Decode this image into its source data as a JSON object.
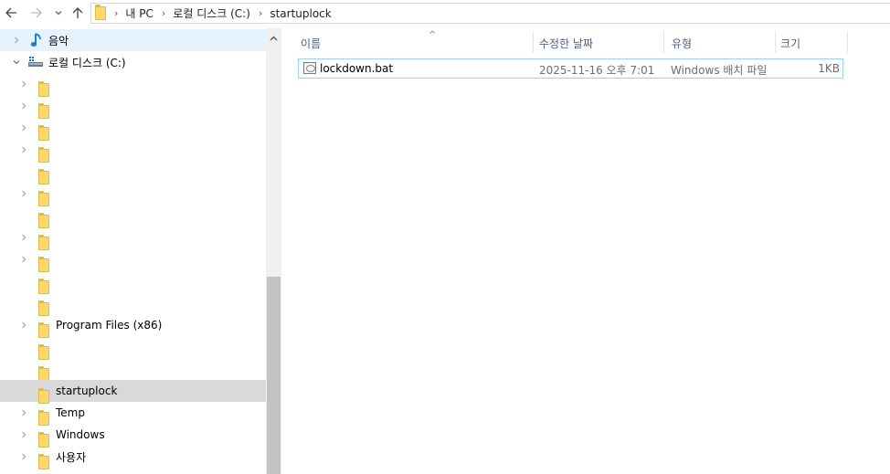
{
  "toolbar": {
    "back_icon": "arrow-left-icon",
    "forward_icon": "arrow-right-icon",
    "recent_icon": "chevron-down-icon",
    "up_icon": "arrow-up-icon"
  },
  "address": {
    "crumbs": [
      "내 PC",
      "로컬 디스크 (C:)",
      "startuplock"
    ]
  },
  "nav": {
    "music_label": "음악",
    "drive_label": "로컬 디스크 (C:)",
    "folders": [
      {
        "label": "",
        "expandable": true
      },
      {
        "label": "",
        "expandable": true
      },
      {
        "label": "",
        "expandable": true
      },
      {
        "label": "",
        "expandable": true
      },
      {
        "label": "",
        "expandable": false
      },
      {
        "label": "",
        "expandable": true
      },
      {
        "label": "",
        "expandable": false
      },
      {
        "label": "",
        "expandable": true
      },
      {
        "label": "",
        "expandable": true
      },
      {
        "label": "",
        "expandable": false
      },
      {
        "label": "",
        "expandable": false
      },
      {
        "label": "Program Files (x86)",
        "expandable": true
      },
      {
        "label": "",
        "expandable": false
      },
      {
        "label": "",
        "expandable": false
      },
      {
        "label": "startuplock",
        "expandable": false,
        "selected": true
      },
      {
        "label": "Temp",
        "expandable": true
      },
      {
        "label": "Windows",
        "expandable": true
      },
      {
        "label": "사용자",
        "expandable": true
      }
    ]
  },
  "columns": {
    "name": "이름",
    "modified": "수정한 날짜",
    "type": "유형",
    "size": "크기"
  },
  "files": [
    {
      "name": "lockdown.bat",
      "modified": "2025-11-16 오후 7:01",
      "type": "Windows 배치 파일",
      "size": "1KB"
    }
  ]
}
